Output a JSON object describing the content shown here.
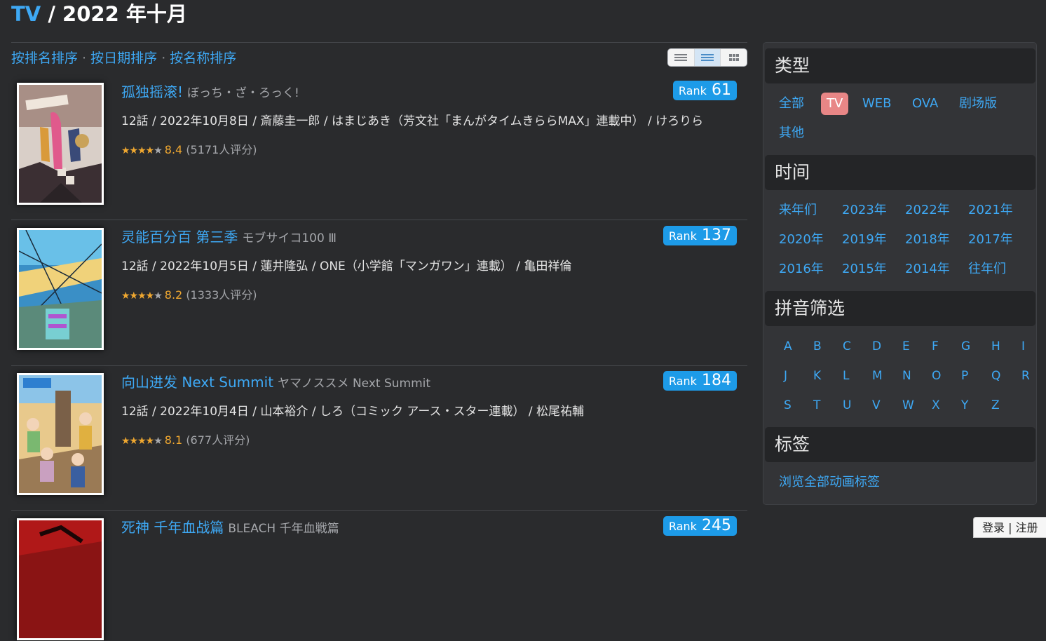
{
  "breadcrumb": {
    "category": "TV",
    "separator": " / ",
    "period": "2022 年十月"
  },
  "sort": {
    "by_rank": "按排名排序",
    "by_date": "按日期排序",
    "by_name": "按名称排序",
    "separator": " · "
  },
  "view_modes": [
    "list-compact-icon",
    "list-detail-icon",
    "grid-icon"
  ],
  "items": [
    {
      "title": "孤独摇滚!",
      "title_jp": "ぼっち・ざ・ろっく!",
      "rank_label": "Rank",
      "rank": "61",
      "info": "12話 / 2022年10月8日 / 斎藤圭一郎 / はまじあき（芳文社「まんがタイムきららMAX」連載中） / けろりら",
      "stars": "★★★★",
      "star_off": "★",
      "score": "8.4",
      "votes": "(5171人评分)"
    },
    {
      "title": "灵能百分百 第三季",
      "title_jp": "モブサイコ100 Ⅲ",
      "rank_label": "Rank",
      "rank": "137",
      "info": "12話 / 2022年10月5日 / 蓮井隆弘 / ONE（小学館「マンガワン」連載） / 亀田祥倫",
      "stars": "★★★★",
      "star_off": "★",
      "score": "8.2",
      "votes": "(1333人评分)"
    },
    {
      "title": "向山进发 Next Summit",
      "title_jp": "ヤマノススメ Next Summit",
      "rank_label": "Rank",
      "rank": "184",
      "info": "12話 / 2022年10月4日 / 山本裕介 / しろ（コミック アース・スター連載） / 松尾祐輔",
      "stars": "★★★★",
      "star_off": "★",
      "score": "8.1",
      "votes": "(677人评分)"
    },
    {
      "title": "死神 千年血战篇",
      "title_jp": "BLEACH 千年血戦篇",
      "rank_label": "Rank",
      "rank": "245"
    }
  ],
  "sidebar": {
    "type": {
      "heading": "类型",
      "options": [
        "全部",
        "TV",
        "WEB",
        "OVA",
        "剧场版",
        "其他"
      ],
      "active": "TV"
    },
    "time": {
      "heading": "时间",
      "options": [
        "来年们",
        "2023年",
        "2022年",
        "2021年",
        "2020年",
        "2019年",
        "2018年",
        "2017年",
        "2016年",
        "2015年",
        "2014年",
        "往年们"
      ]
    },
    "pinyin": {
      "heading": "拼音筛选",
      "letters": [
        "A",
        "B",
        "C",
        "D",
        "E",
        "F",
        "G",
        "H",
        "I",
        "J",
        "K",
        "L",
        "M",
        "N",
        "O",
        "P",
        "Q",
        "R",
        "S",
        "T",
        "U",
        "V",
        "W",
        "X",
        "Y",
        "Z"
      ]
    },
    "tags": {
      "heading": "标签",
      "browse_all": "浏览全部动画标签"
    }
  },
  "login": {
    "login": "登录",
    "separator": " | ",
    "register": "注册"
  },
  "colors": {
    "link": "#3ea9f5",
    "rank_badge": "#1d9be8",
    "active_tag": "#e88686",
    "star": "#f0a830",
    "background": "#2a2b2d"
  }
}
